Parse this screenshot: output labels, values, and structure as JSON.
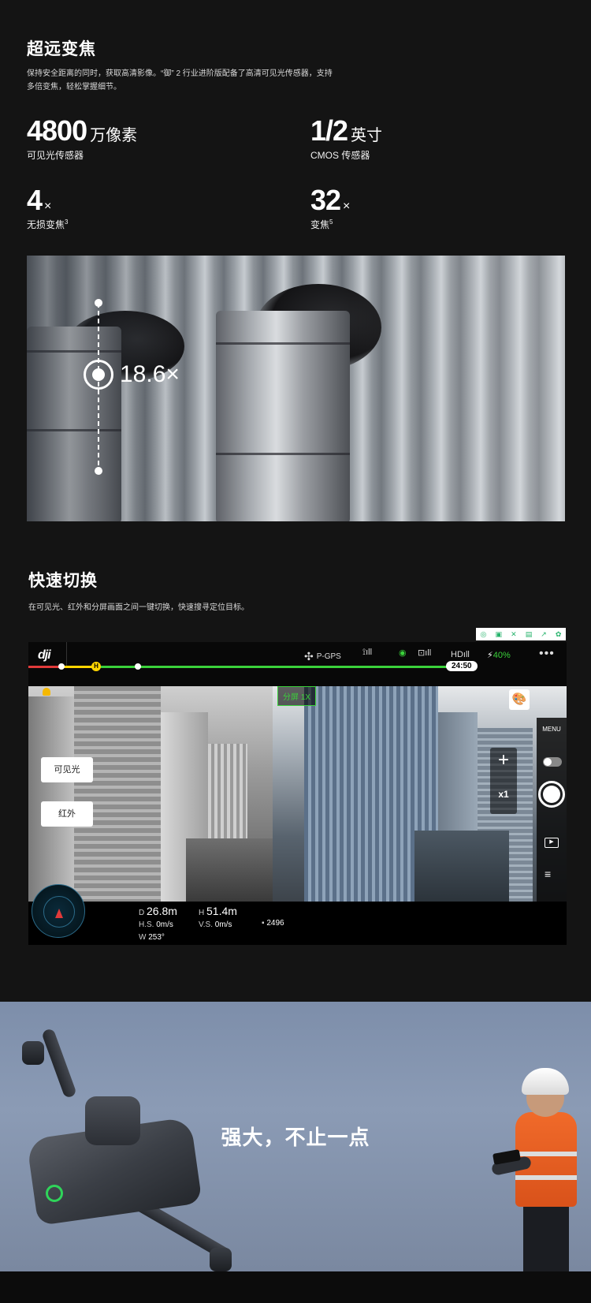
{
  "zoom_section": {
    "title": "超远变焦",
    "description_line1": "保持安全距离的同时，获取高清影像。“御” 2 行业进阶版配备了高清可见光传感器，支持",
    "description_line2": "多倍变焦，轻松掌握细节。",
    "specs": [
      {
        "value": "4800",
        "unit": "万像素",
        "label": "可见光传感器",
        "sup": ""
      },
      {
        "value": "1/2",
        "unit": "英寸",
        "label": "CMOS 传感器",
        "sup": ""
      },
      {
        "value": "4",
        "unit": "×",
        "label": "无损变焦",
        "sup": "3"
      },
      {
        "value": "32",
        "unit": "×",
        "label": "变焦",
        "sup": "5"
      }
    ],
    "zoom_readout": "18.6×"
  },
  "switch_section": {
    "title": "快速切换",
    "description": "在可见光、红外和分屏画面之间一键切换，快速搜寻定位目标。",
    "app": {
      "logo": "dji",
      "gps_label": "P-GPS",
      "hd_label": "HD",
      "battery_pct": "40%",
      "timer": "24:50",
      "home_marker": "H",
      "split_button": "分屏 1X",
      "visible_button": "可见光",
      "ir_button": "红外",
      "zoom_level": "x1",
      "menu_label": "MENU",
      "telemetry": {
        "d_label": "D",
        "d_value": "26.8m",
        "h_label": "H",
        "h_value": "51.4m",
        "hs_label": "H.S.",
        "hs_value": "0m/s",
        "vs_label": "V.S.",
        "vs_value": "0m/s",
        "heading_label": "W",
        "heading_value": "253°",
        "storage_value": "2496"
      }
    }
  },
  "hero_section": {
    "title": "强大，不止一点"
  },
  "colors": {
    "background": "#141414",
    "accent_green": "#3ad13a",
    "warning_yellow": "#ffd500",
    "danger_red": "#e03a3a"
  }
}
